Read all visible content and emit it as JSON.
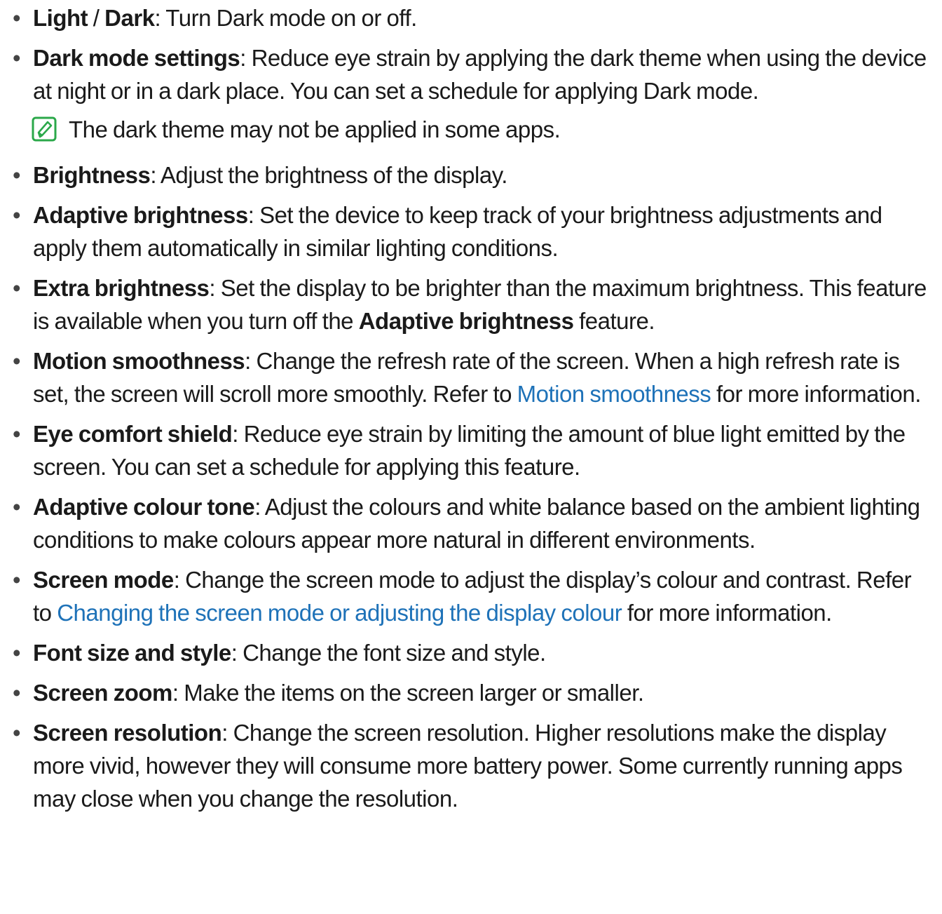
{
  "bullet_char": "•",
  "items": [
    {
      "id": "light-dark",
      "term1": "Light",
      "sep": " / ",
      "term2": "Dark",
      "desc": ": Turn Dark mode on or off."
    },
    {
      "id": "dark-mode-settings",
      "term": "Dark mode settings",
      "desc": ": Reduce eye strain by applying the dark theme when using the device at night or in a dark place. You can set a schedule for applying Dark mode."
    },
    {
      "id": "brightness",
      "term": "Brightness",
      "desc": ": Adjust the brightness of the display."
    },
    {
      "id": "adaptive-brightness",
      "term": "Adaptive brightness",
      "desc": ": Set the device to keep track of your brightness adjustments and apply them automatically in similar lighting conditions."
    },
    {
      "id": "extra-brightness",
      "term": "Extra brightness",
      "desc1": ": Set the display to be brighter than the maximum brightness. This feature is available when you turn off the ",
      "inline_term": "Adaptive brightness",
      "desc2": " feature."
    },
    {
      "id": "motion-smoothness",
      "term": "Motion smoothness",
      "desc1": ": Change the refresh rate of the screen. When a high refresh rate is set, the screen will scroll more smoothly. Refer to ",
      "link": "Motion smoothness",
      "desc2": " for more information."
    },
    {
      "id": "eye-comfort-shield",
      "term": "Eye comfort shield",
      "desc": ": Reduce eye strain by limiting the amount of blue light emitted by the screen. You can set a schedule for applying this feature."
    },
    {
      "id": "adaptive-colour-tone",
      "term": "Adaptive colour tone",
      "desc": ": Adjust the colours and white balance based on the ambient lighting conditions to make colours appear more natural in different environments."
    },
    {
      "id": "screen-mode",
      "term": "Screen mode",
      "desc1": ": Change the screen mode to adjust the display’s colour and contrast. Refer to ",
      "link": "Changing the screen mode or adjusting the display colour",
      "desc2": " for more information."
    },
    {
      "id": "font-size-style",
      "term": "Font size and style",
      "desc": ": Change the font size and style."
    },
    {
      "id": "screen-zoom",
      "term": "Screen zoom",
      "desc": ": Make the items on the screen larger or smaller."
    },
    {
      "id": "screen-resolution",
      "term": "Screen resolution",
      "desc": ": Change the screen resolution. Higher resolutions make the display more vivid, however they will consume more battery power. Some currently running apps may close when you change the resolution."
    }
  ],
  "note": {
    "icon": "note-pencil-icon",
    "text": "The dark theme may not be applied in some apps."
  },
  "colors": {
    "text": "#1a1a1a",
    "link": "#1e72b8",
    "note_icon": "#2ba84a"
  }
}
